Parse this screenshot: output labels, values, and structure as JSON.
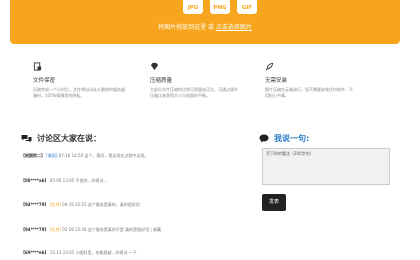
{
  "banner": {
    "formats": [
      "JPG",
      "PNG",
      "GIF"
    ],
    "drop_text": "将图片拖放到这里 或 ",
    "choose_link": "点击选择图片",
    "color": "#f7a51c"
  },
  "features": [
    {
      "icon": "file-lock-icon",
      "title": "文件保密",
      "desc": "压缩完成一个小时后，文件将自动永久删除的服务器",
      "desc2": "端时，100%保障您的隐私。"
    },
    {
      "icon": "diamond-icon",
      "title": "压缩质量",
      "desc": "大部分文件压缩的比例可质量成正比，可通过调节",
      "desc2": "压缩比来获得大小与质量的平衡。"
    },
    {
      "icon": "rocket-icon",
      "title": "无需安装",
      "desc": "图片压缩在云端进行，您不需要安装任何软件，不",
      "desc2": "用担心中毒。"
    }
  ],
  "discussion": {
    "title": "讨论区大家在说：",
    "comments": [
      {
        "user": "【刻脱阿二】",
        "tag": "[美国]",
        "time": "07-16 14:50",
        "text": "这个，我问，我出现在过程中出现。"
      },
      {
        "user": "【88****ab】",
        "tag": "",
        "time": "05-06 13:05",
        "text": "手里的…你再试…"
      },
      {
        "user": "【94****79】",
        "tag": "[北京]",
        "time": "04-19 22:55",
        "text": "这个服务是真的，真的很好用"
      },
      {
        "user": "【94****79】",
        "tag": "[北京]",
        "time": "03-28 15:44",
        "text": "这个服务是真的不是 真的是很好用 | 收藏"
      },
      {
        "user": "【69****eb】",
        "tag": "",
        "time": "15-13 23:05",
        "text": "小图好用，也能超越…你再试 一下"
      }
    ]
  },
  "comment_box": {
    "title": "我说一句:",
    "placeholder": "写下你的看法（200字内）",
    "submit": "发表"
  }
}
